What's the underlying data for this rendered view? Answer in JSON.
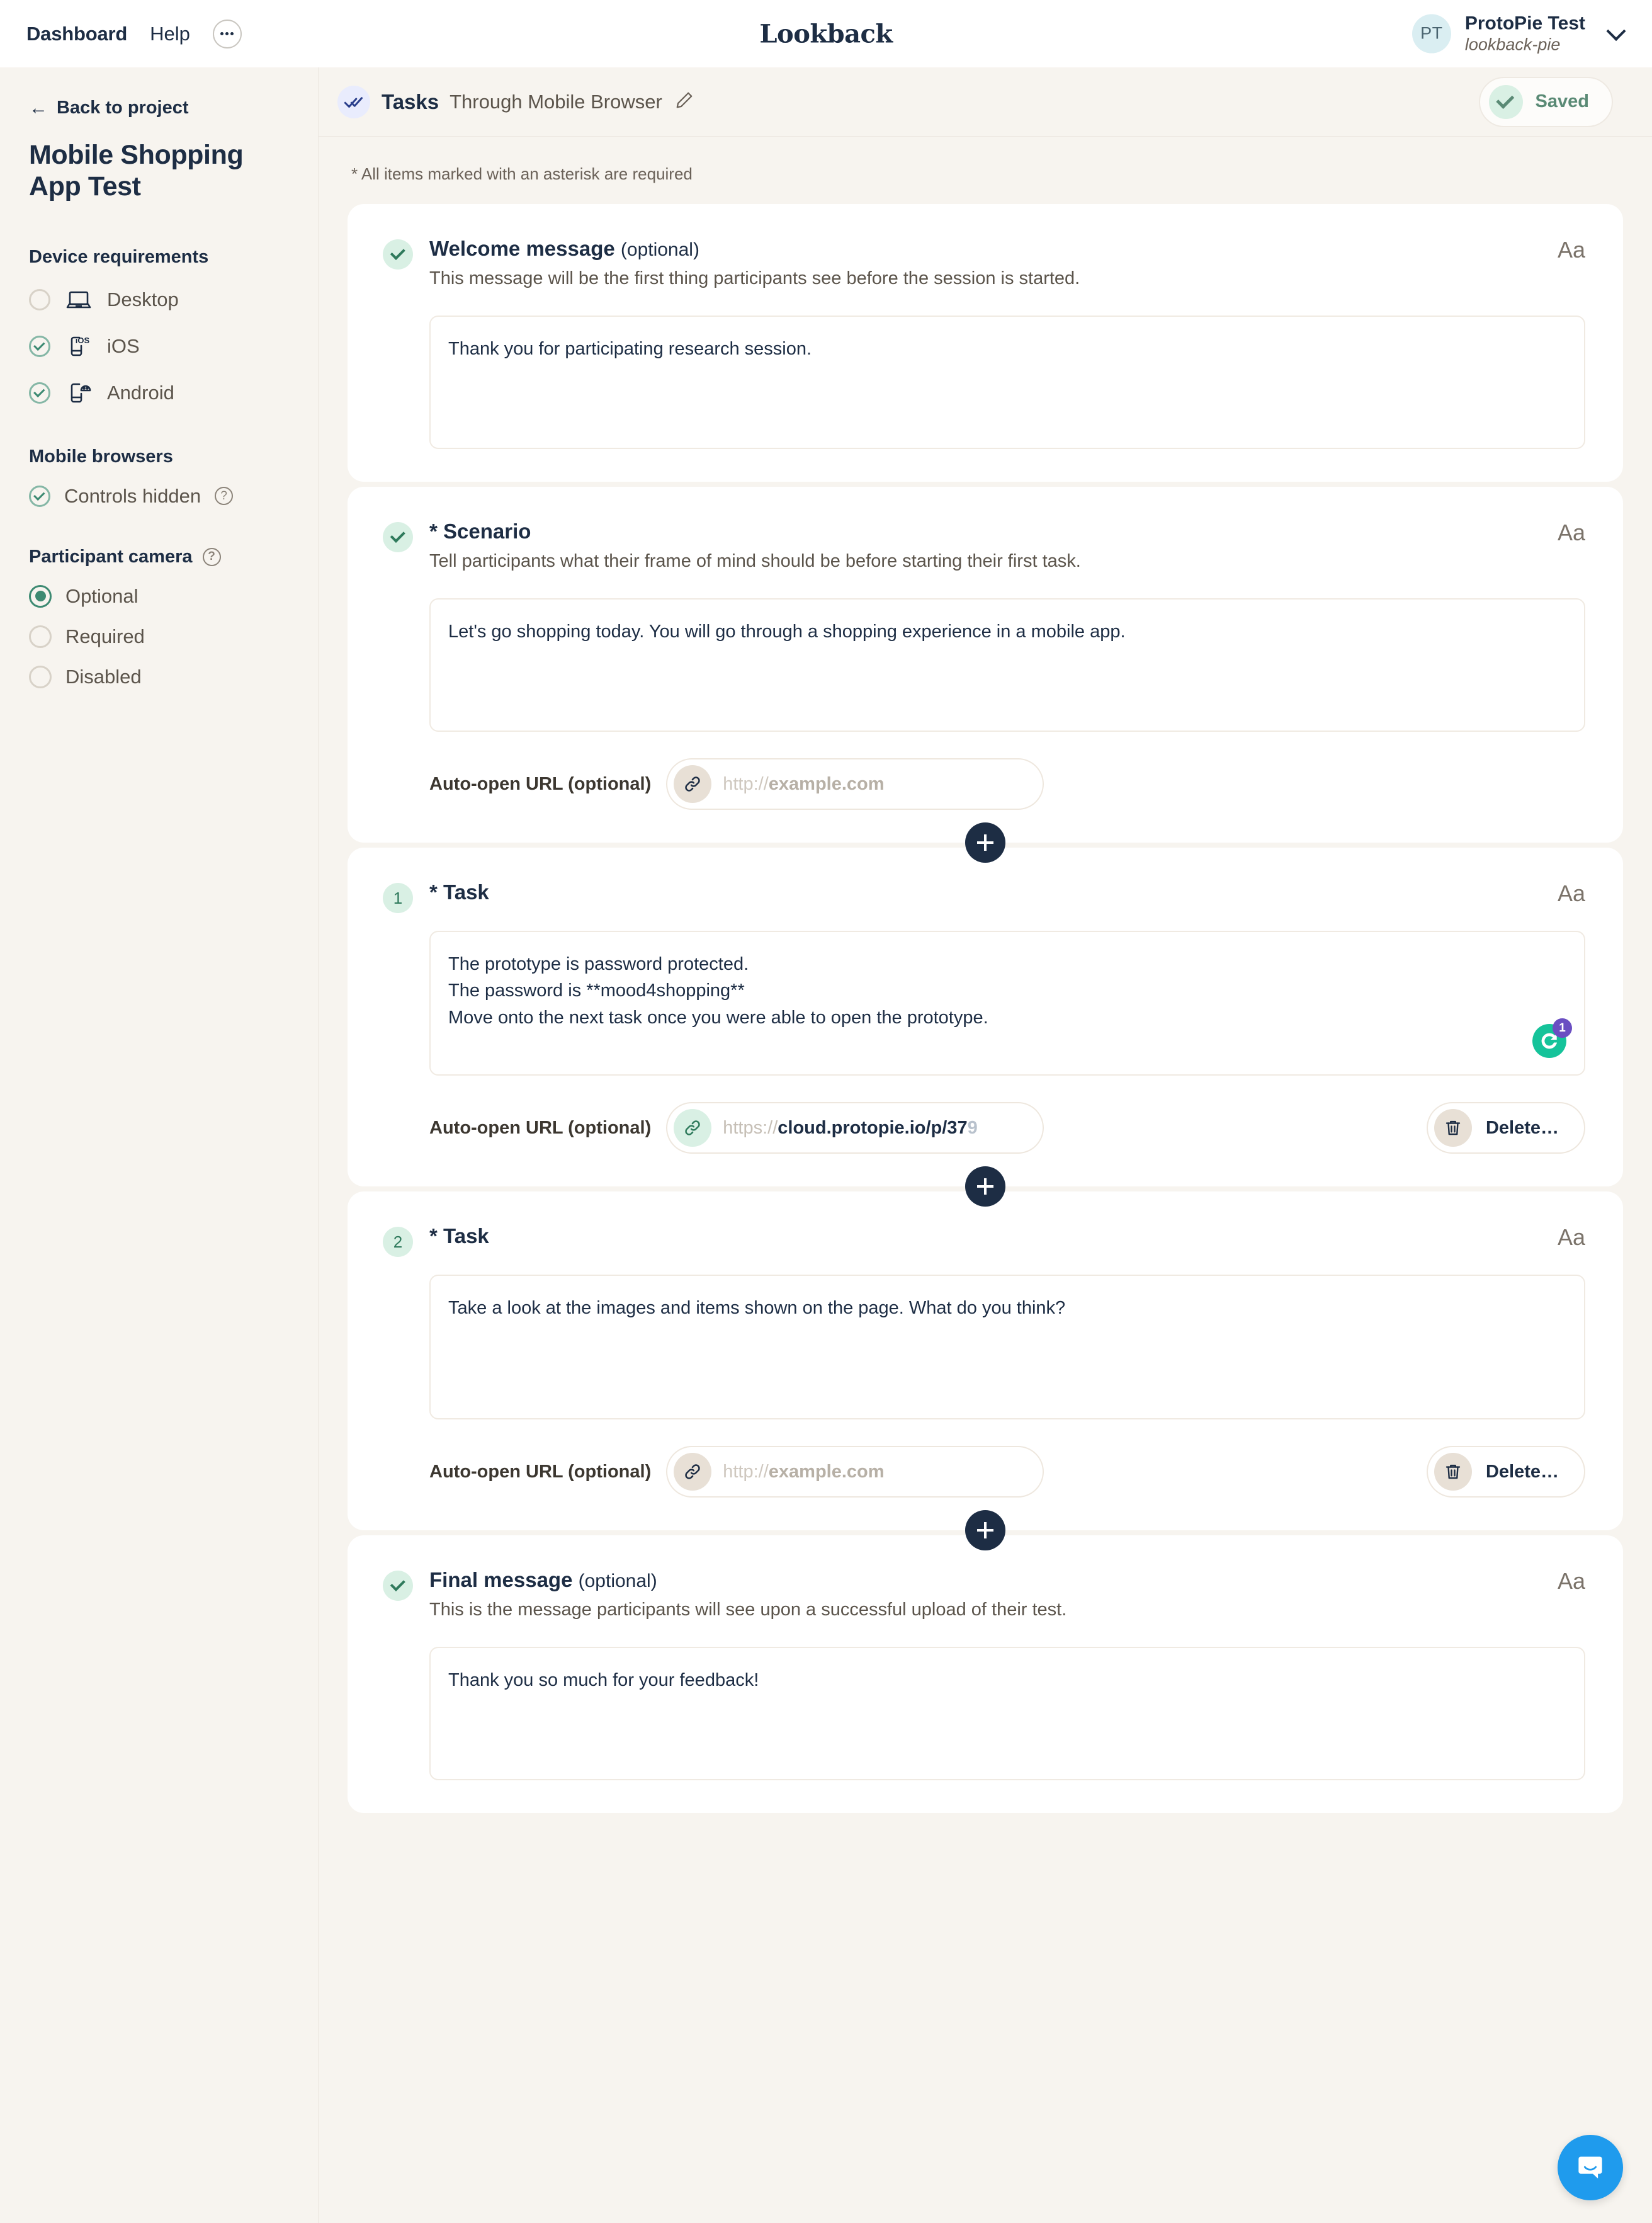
{
  "topbar": {
    "dashboard": "Dashboard",
    "help": "Help",
    "brand": "Lookback",
    "account": {
      "initials": "PT",
      "name": "ProtoPie Test",
      "workspace": "lookback-pie"
    }
  },
  "sidebar": {
    "back": "Back to project",
    "project_title": "Mobile Shopping App Test",
    "device_requirements": {
      "heading": "Device requirements",
      "items": [
        {
          "label": "Desktop",
          "checked": false,
          "icon": "laptop-icon"
        },
        {
          "label": "iOS",
          "checked": true,
          "icon": "ios-phone-icon"
        },
        {
          "label": "Android",
          "checked": true,
          "icon": "android-phone-icon"
        }
      ]
    },
    "mobile_browsers": {
      "heading": "Mobile browsers",
      "items": [
        {
          "label": "Controls hidden",
          "checked": true,
          "help": "?"
        }
      ]
    },
    "participant_camera": {
      "heading": "Participant camera",
      "help": "?",
      "options": [
        {
          "label": "Optional",
          "selected": true
        },
        {
          "label": "Required",
          "selected": false
        },
        {
          "label": "Disabled",
          "selected": false
        }
      ]
    }
  },
  "main": {
    "header": {
      "icon": "double-check-icon",
      "title": "Tasks",
      "subtitle": "Through Mobile Browser",
      "edit_icon": "pencil-icon",
      "save_status": "Saved"
    },
    "asterisk_note": "* All items marked with an asterisk are required",
    "url_label": "Auto-open URL (optional)",
    "url_placeholder": "http://example.com",
    "delete_label": "Delete…",
    "format_icon_label": "Aa",
    "sections": [
      {
        "badge": "check",
        "title": "Welcome message",
        "optional_suffix": "(optional)",
        "description": "This message will be the first thing participants see before the session is started.",
        "value": "Thank you for participating research session.",
        "has_url": false,
        "has_delete": false
      },
      {
        "badge": "check",
        "title": "* Scenario",
        "optional_suffix": "",
        "description": "Tell participants what their frame of mind should be before starting their first task.",
        "value": "Let's go shopping today. You will go through a shopping experience in a mobile app.",
        "has_url": true,
        "url_value": "",
        "has_delete": false
      },
      {
        "badge": "1",
        "title": "* Task",
        "optional_suffix": "",
        "description": "",
        "value": "The prototype is password protected.\nThe password is **mood4shopping**\nMove onto the next task once you were able to open the prototype.",
        "has_url": true,
        "url_value": "https://cloud.protopie.io/p/379",
        "url_scheme": "https://",
        "url_body": "cloud.protopie.io/p/37",
        "url_tail": "9",
        "has_delete": true,
        "grammarly_count": "1"
      },
      {
        "badge": "2",
        "title": "* Task",
        "optional_suffix": "",
        "description": "",
        "value": "Take a look at the images and items shown on the page. What do you think?",
        "has_url": true,
        "url_value": "",
        "has_delete": true
      },
      {
        "badge": "check",
        "title": "Final message",
        "optional_suffix": "(optional)",
        "description": "This is the message participants will see upon a successful upload of their test.",
        "value": "Thank you so much for your feedback!",
        "has_url": false,
        "has_delete": false
      }
    ],
    "add_button_label": "+"
  },
  "widgets": {
    "intercom": "intercom-chat-icon"
  }
}
